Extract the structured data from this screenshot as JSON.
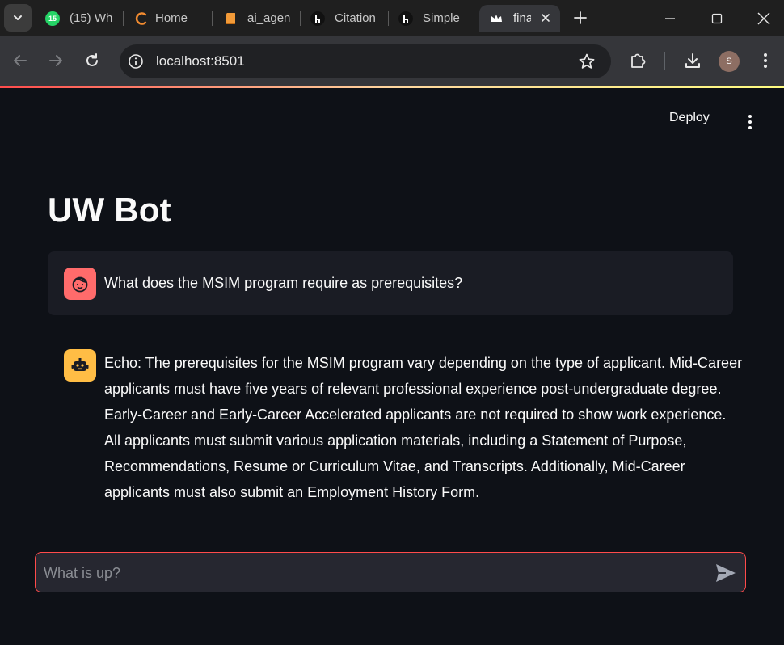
{
  "browser": {
    "tabs": [
      {
        "label": "(15) Wh",
        "favicon": "whatsapp-icon",
        "badge": "15",
        "color": "#25d366"
      },
      {
        "label": "Home",
        "favicon": "home-icon",
        "color": "#f28b30"
      },
      {
        "label": "ai_agen",
        "favicon": "book-icon",
        "color": "#f29a38"
      },
      {
        "label": "Citation",
        "favicon": "llama-icon",
        "color": "#ffffff"
      },
      {
        "label": "Simple",
        "favicon": "llama-icon",
        "color": "#ffffff"
      },
      {
        "label": "fina",
        "favicon": "streamlit-crown-icon",
        "color": "#ffffff",
        "active": true
      }
    ],
    "address": "localhost:8501",
    "profile_initial": "S"
  },
  "app": {
    "deploy_label": "Deploy",
    "title": "UW Bot",
    "messages": [
      {
        "role": "user",
        "avatar": "user-face-icon",
        "text": "What does the MSIM program require as prerequisites?"
      },
      {
        "role": "assistant",
        "avatar": "robot-icon",
        "text": "Echo: The prerequisites for the MSIM program vary depending on the type of applicant. Mid-Career applicants must have five years of relevant professional experience post-undergraduate degree. Early-Career and Early-Career Accelerated applicants are not required to show work experience. All applicants must submit various application materials, including a Statement of Purpose, Recommendations, Resume or Curriculum Vitae, and Transcripts. Additionally, Mid-Career applicants must also submit an Employment History Form."
      }
    ],
    "input": {
      "placeholder": "What is up?",
      "value": ""
    }
  },
  "colors": {
    "accent": "#ff4b4b",
    "user_avatar": "#ff6b6b",
    "bot_avatar": "#ffbd45",
    "background": "#0e1117"
  }
}
